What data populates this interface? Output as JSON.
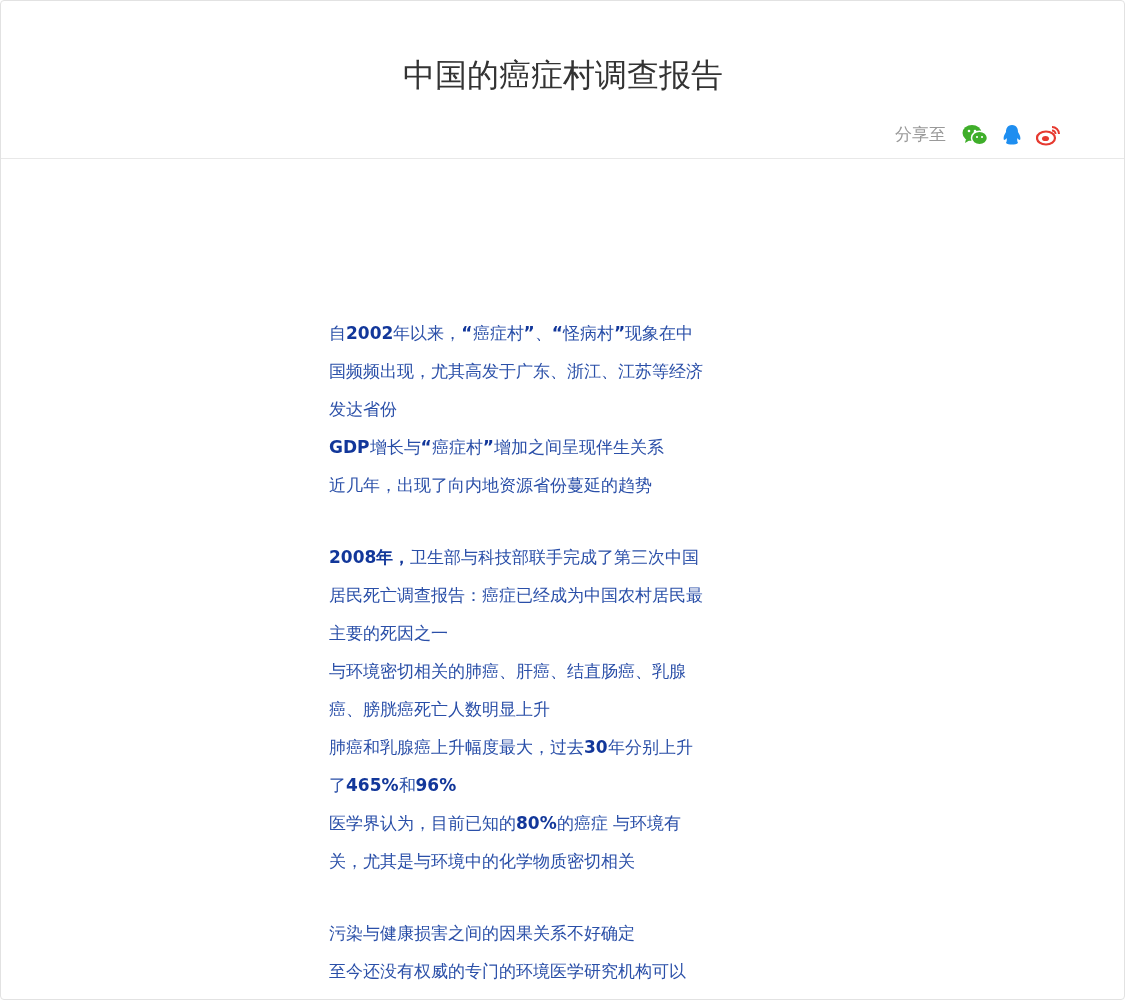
{
  "header": {
    "title": "中国的癌症村调查报告",
    "share": {
      "label": "分享至",
      "targets": [
        {
          "kind": "wechat"
        },
        {
          "kind": "qq"
        },
        {
          "kind": "weibo"
        }
      ]
    }
  },
  "article": {
    "sections": [
      [
        "自**2002**年以来，**“**癌症村**”**、**“**怪病村**”**现象在中国频频出现，尤其高发于广东、浙江、江苏等经济发达省份",
        "**GDP**增长与**“**癌症村**”**增加之间呈现伴生关系",
        "近几年，出现了向内地资源省份蔓延的趋势"
      ],
      [
        "**2008年，**卫生部与科技部联手完成了第三次中国居民死亡调查报告：癌症已经成为中国农村居民最主要的死因之一",
        "与环境密切相关的肺癌、肝癌、结直肠癌、乳腺癌、膀胱癌死亡人数明显上升",
        "肺癌和乳腺癌上升幅度最大，过去**30**年分别上升了**465%**和**96%**",
        "医学界认为，目前已知的**80%**的癌症 与环境有关，尤其是与环境中的化学物质密切相关"
      ],
      [
        "污染与健康损害之间的因果关系不好确定",
        "至今还没有权威的专门的环境医学研究机构可以"
      ]
    ]
  }
}
